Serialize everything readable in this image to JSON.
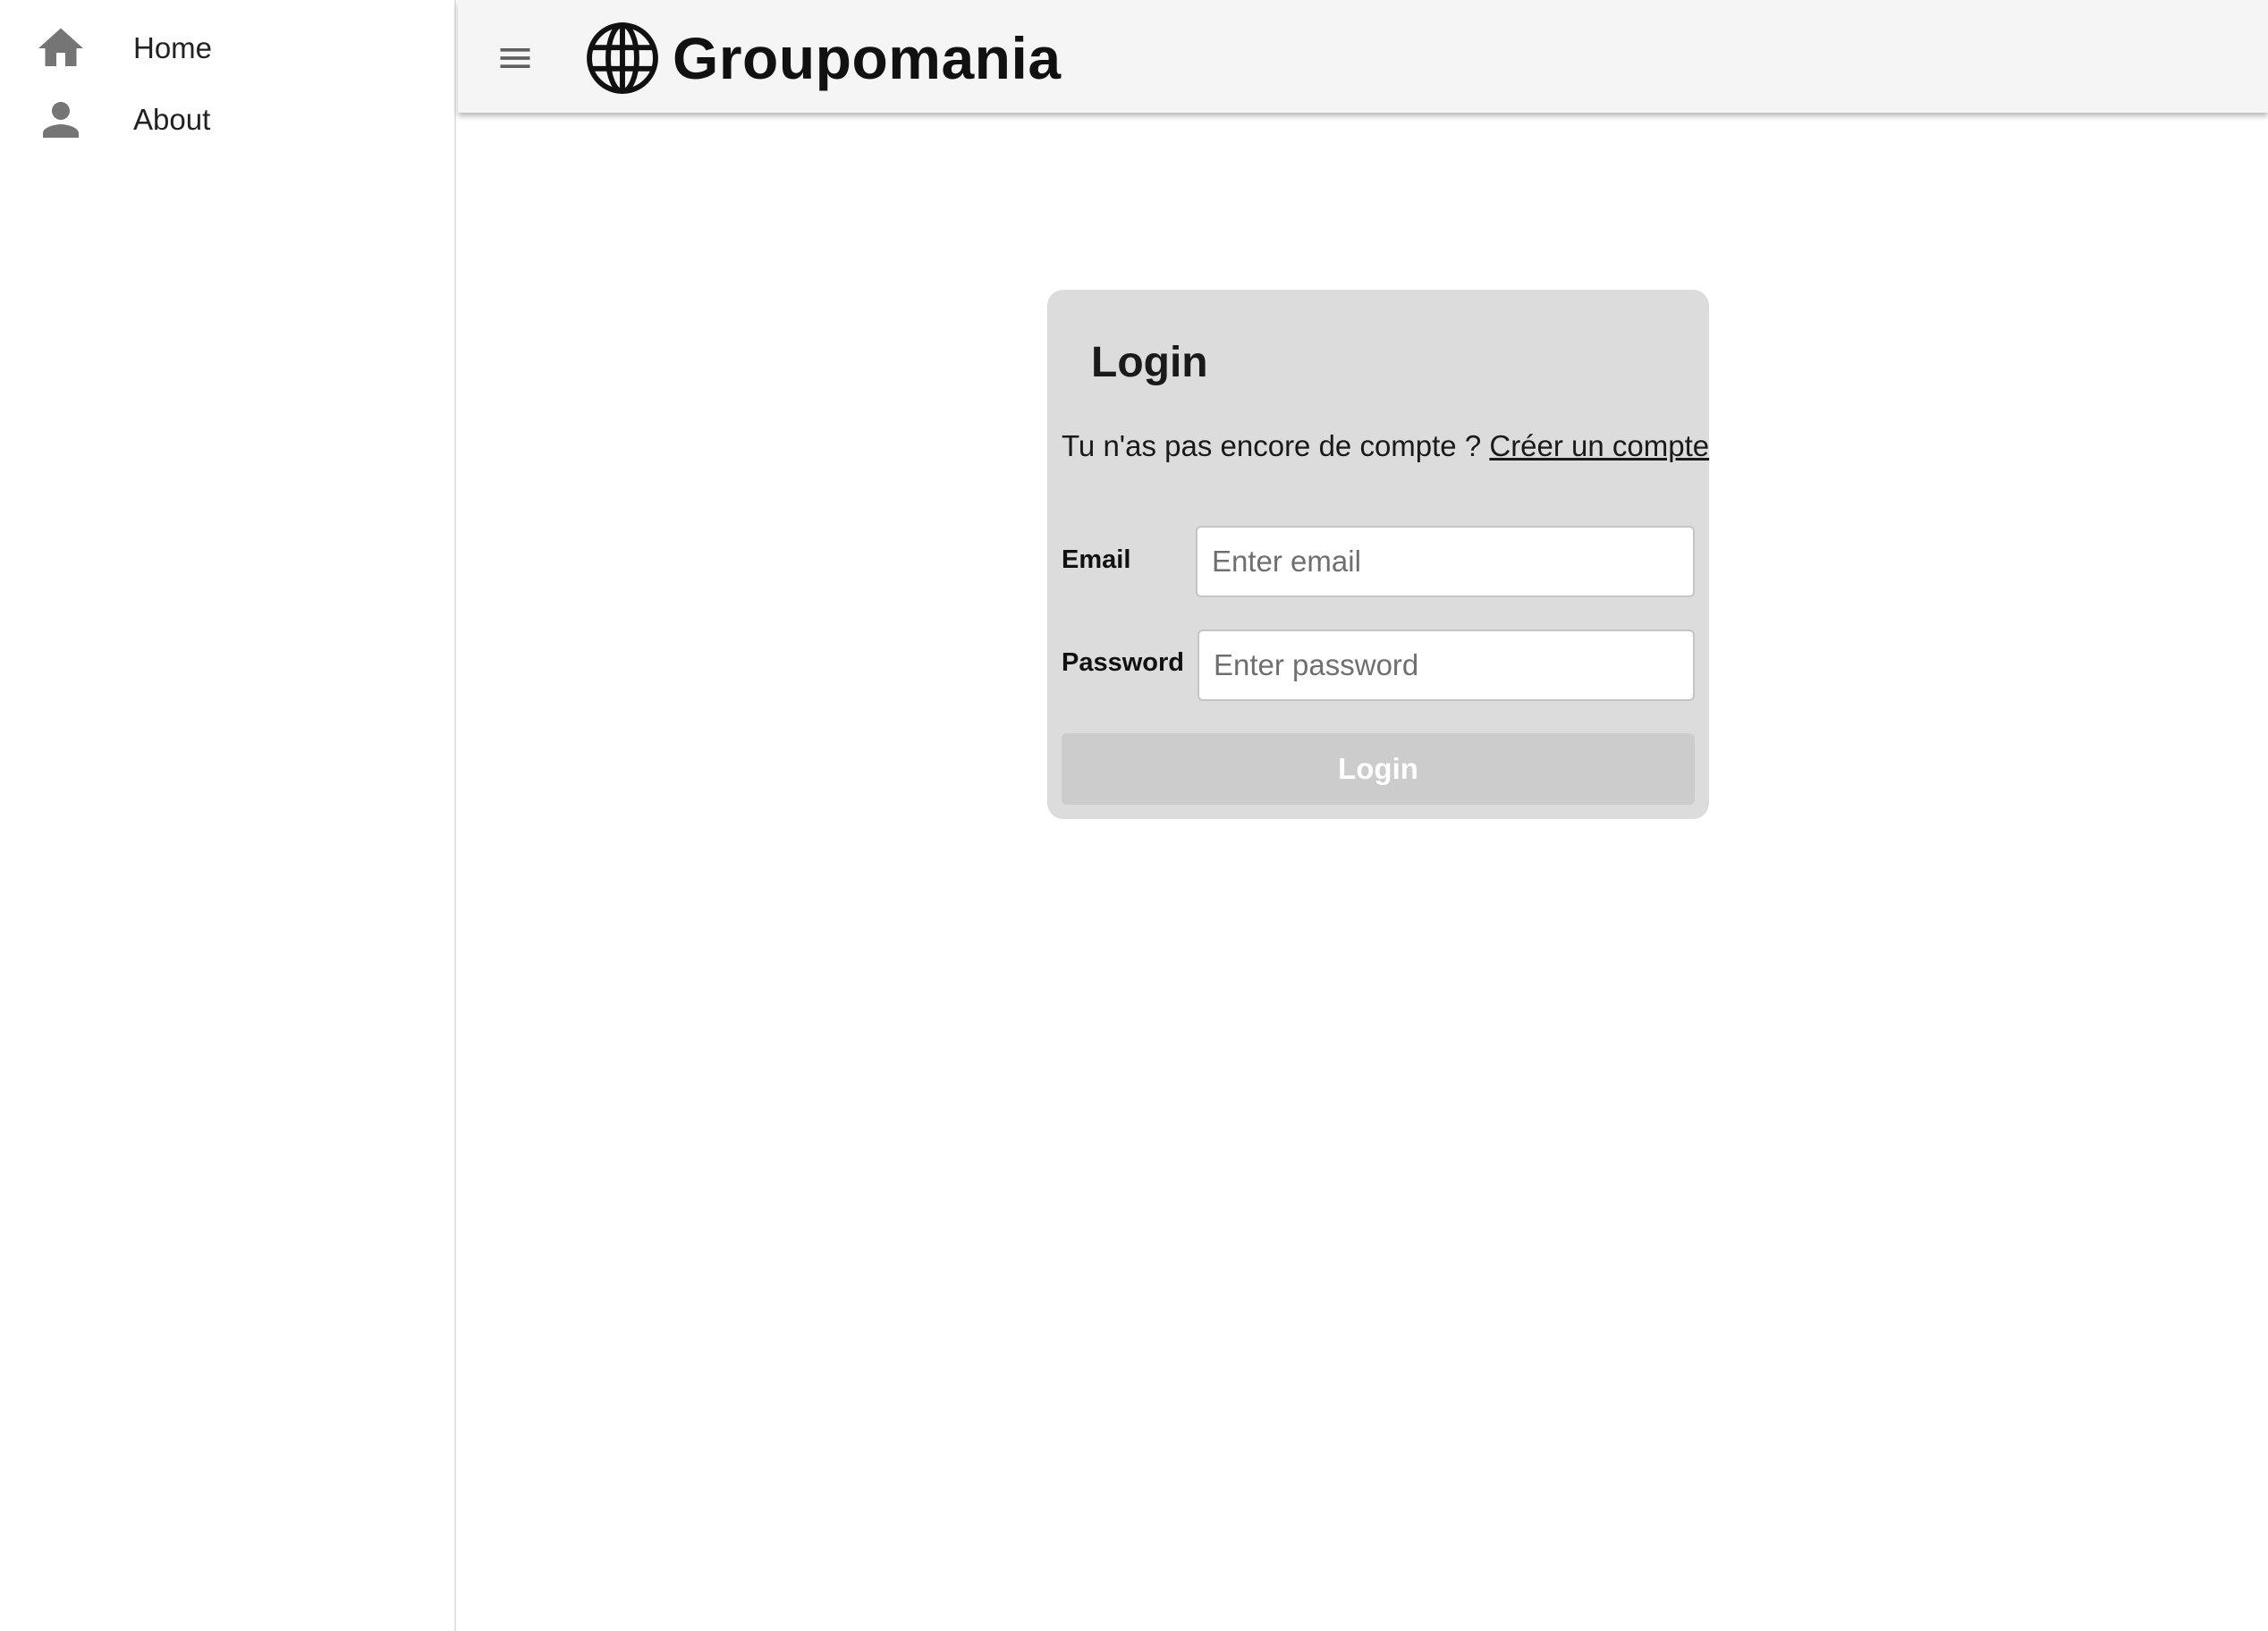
{
  "sidebar": {
    "items": [
      {
        "label": "Home",
        "icon": "home-icon"
      },
      {
        "label": "About",
        "icon": "person-icon"
      }
    ]
  },
  "appbar": {
    "menu_icon": "hamburger-menu-icon",
    "logo_icon": "globe-icon",
    "brand_name": "Groupomania"
  },
  "login_card": {
    "title": "Login",
    "signup_prompt": "Tu n'as pas encore de compte ?",
    "signup_link": "Créer un compte",
    "email_label": "Email",
    "email_placeholder": "Enter email",
    "password_label": "Password",
    "password_placeholder": "Enter password",
    "submit_label": "Login"
  },
  "colors": {
    "appbar_bg": "#f5f5f5",
    "card_bg": "#dcdcdc",
    "button_disabled_bg": "#cccccc",
    "icon_gray": "#757575"
  }
}
